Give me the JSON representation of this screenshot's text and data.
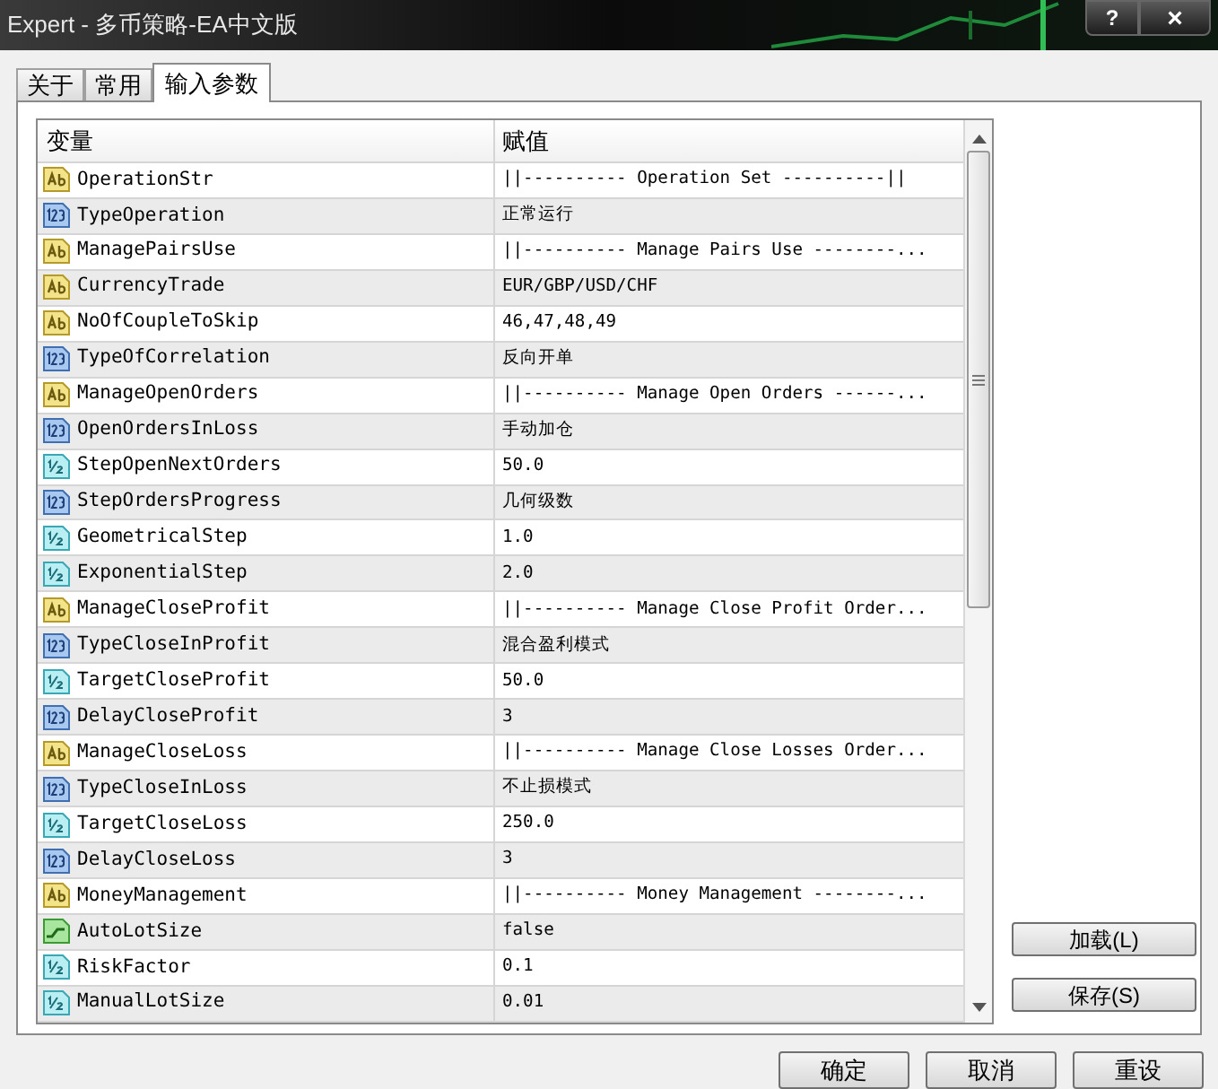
{
  "window": {
    "title": "Expert - 多币策略-EA中文版",
    "help_button": "?",
    "close_button": "×"
  },
  "tabs": [
    {
      "label": "关于",
      "selected": false
    },
    {
      "label": "常用",
      "selected": false
    },
    {
      "label": "输入参数",
      "selected": true
    }
  ],
  "table": {
    "columns": [
      "变量",
      "赋值"
    ],
    "rows": [
      {
        "kind": "string",
        "name": "OperationStr",
        "value": "||---------- Operation Set ----------||"
      },
      {
        "kind": "int",
        "name": "TypeOperation",
        "value": "正常运行"
      },
      {
        "kind": "string",
        "name": "ManagePairsUse",
        "value": "||---------- Manage Pairs Use --------..."
      },
      {
        "kind": "string",
        "name": "CurrencyTrade",
        "value": "EUR/GBP/USD/CHF"
      },
      {
        "kind": "string",
        "name": "NoOfCoupleToSkip",
        "value": "46,47,48,49"
      },
      {
        "kind": "int",
        "name": "TypeOfCorrelation",
        "value": "反向开单"
      },
      {
        "kind": "string",
        "name": "ManageOpenOrders",
        "value": "||---------- Manage Open Orders ------..."
      },
      {
        "kind": "int",
        "name": "OpenOrdersInLoss",
        "value": "手动加仓"
      },
      {
        "kind": "double",
        "name": "StepOpenNextOrders",
        "value": "50.0"
      },
      {
        "kind": "int",
        "name": "StepOrdersProgress",
        "value": "几何级数"
      },
      {
        "kind": "double",
        "name": "GeometricalStep",
        "value": "1.0"
      },
      {
        "kind": "double",
        "name": "ExponentialStep",
        "value": "2.0"
      },
      {
        "kind": "string",
        "name": "ManageCloseProfit",
        "value": "||---------- Manage Close Profit Order..."
      },
      {
        "kind": "int",
        "name": "TypeCloseInProfit",
        "value": "混合盈利模式"
      },
      {
        "kind": "double",
        "name": "TargetCloseProfit",
        "value": "50.0"
      },
      {
        "kind": "int",
        "name": "DelayCloseProfit",
        "value": "3"
      },
      {
        "kind": "string",
        "name": "ManageCloseLoss",
        "value": "||---------- Manage Close Losses Order..."
      },
      {
        "kind": "int",
        "name": "TypeCloseInLoss",
        "value": "不止损模式"
      },
      {
        "kind": "double",
        "name": "TargetCloseLoss",
        "value": "250.0"
      },
      {
        "kind": "int",
        "name": "DelayCloseLoss",
        "value": "3"
      },
      {
        "kind": "string",
        "name": "MoneyManagement",
        "value": "||---------- Money Management --------..."
      },
      {
        "kind": "bool",
        "name": "AutoLotSize",
        "value": "false"
      },
      {
        "kind": "double",
        "name": "RiskFactor",
        "value": "0.1"
      },
      {
        "kind": "double",
        "name": "ManualLotSize",
        "value": "0.01"
      }
    ]
  },
  "side_buttons": [
    "加载(L)",
    "保存(S)"
  ],
  "footer_buttons": [
    "确定",
    "取消",
    "重设"
  ]
}
